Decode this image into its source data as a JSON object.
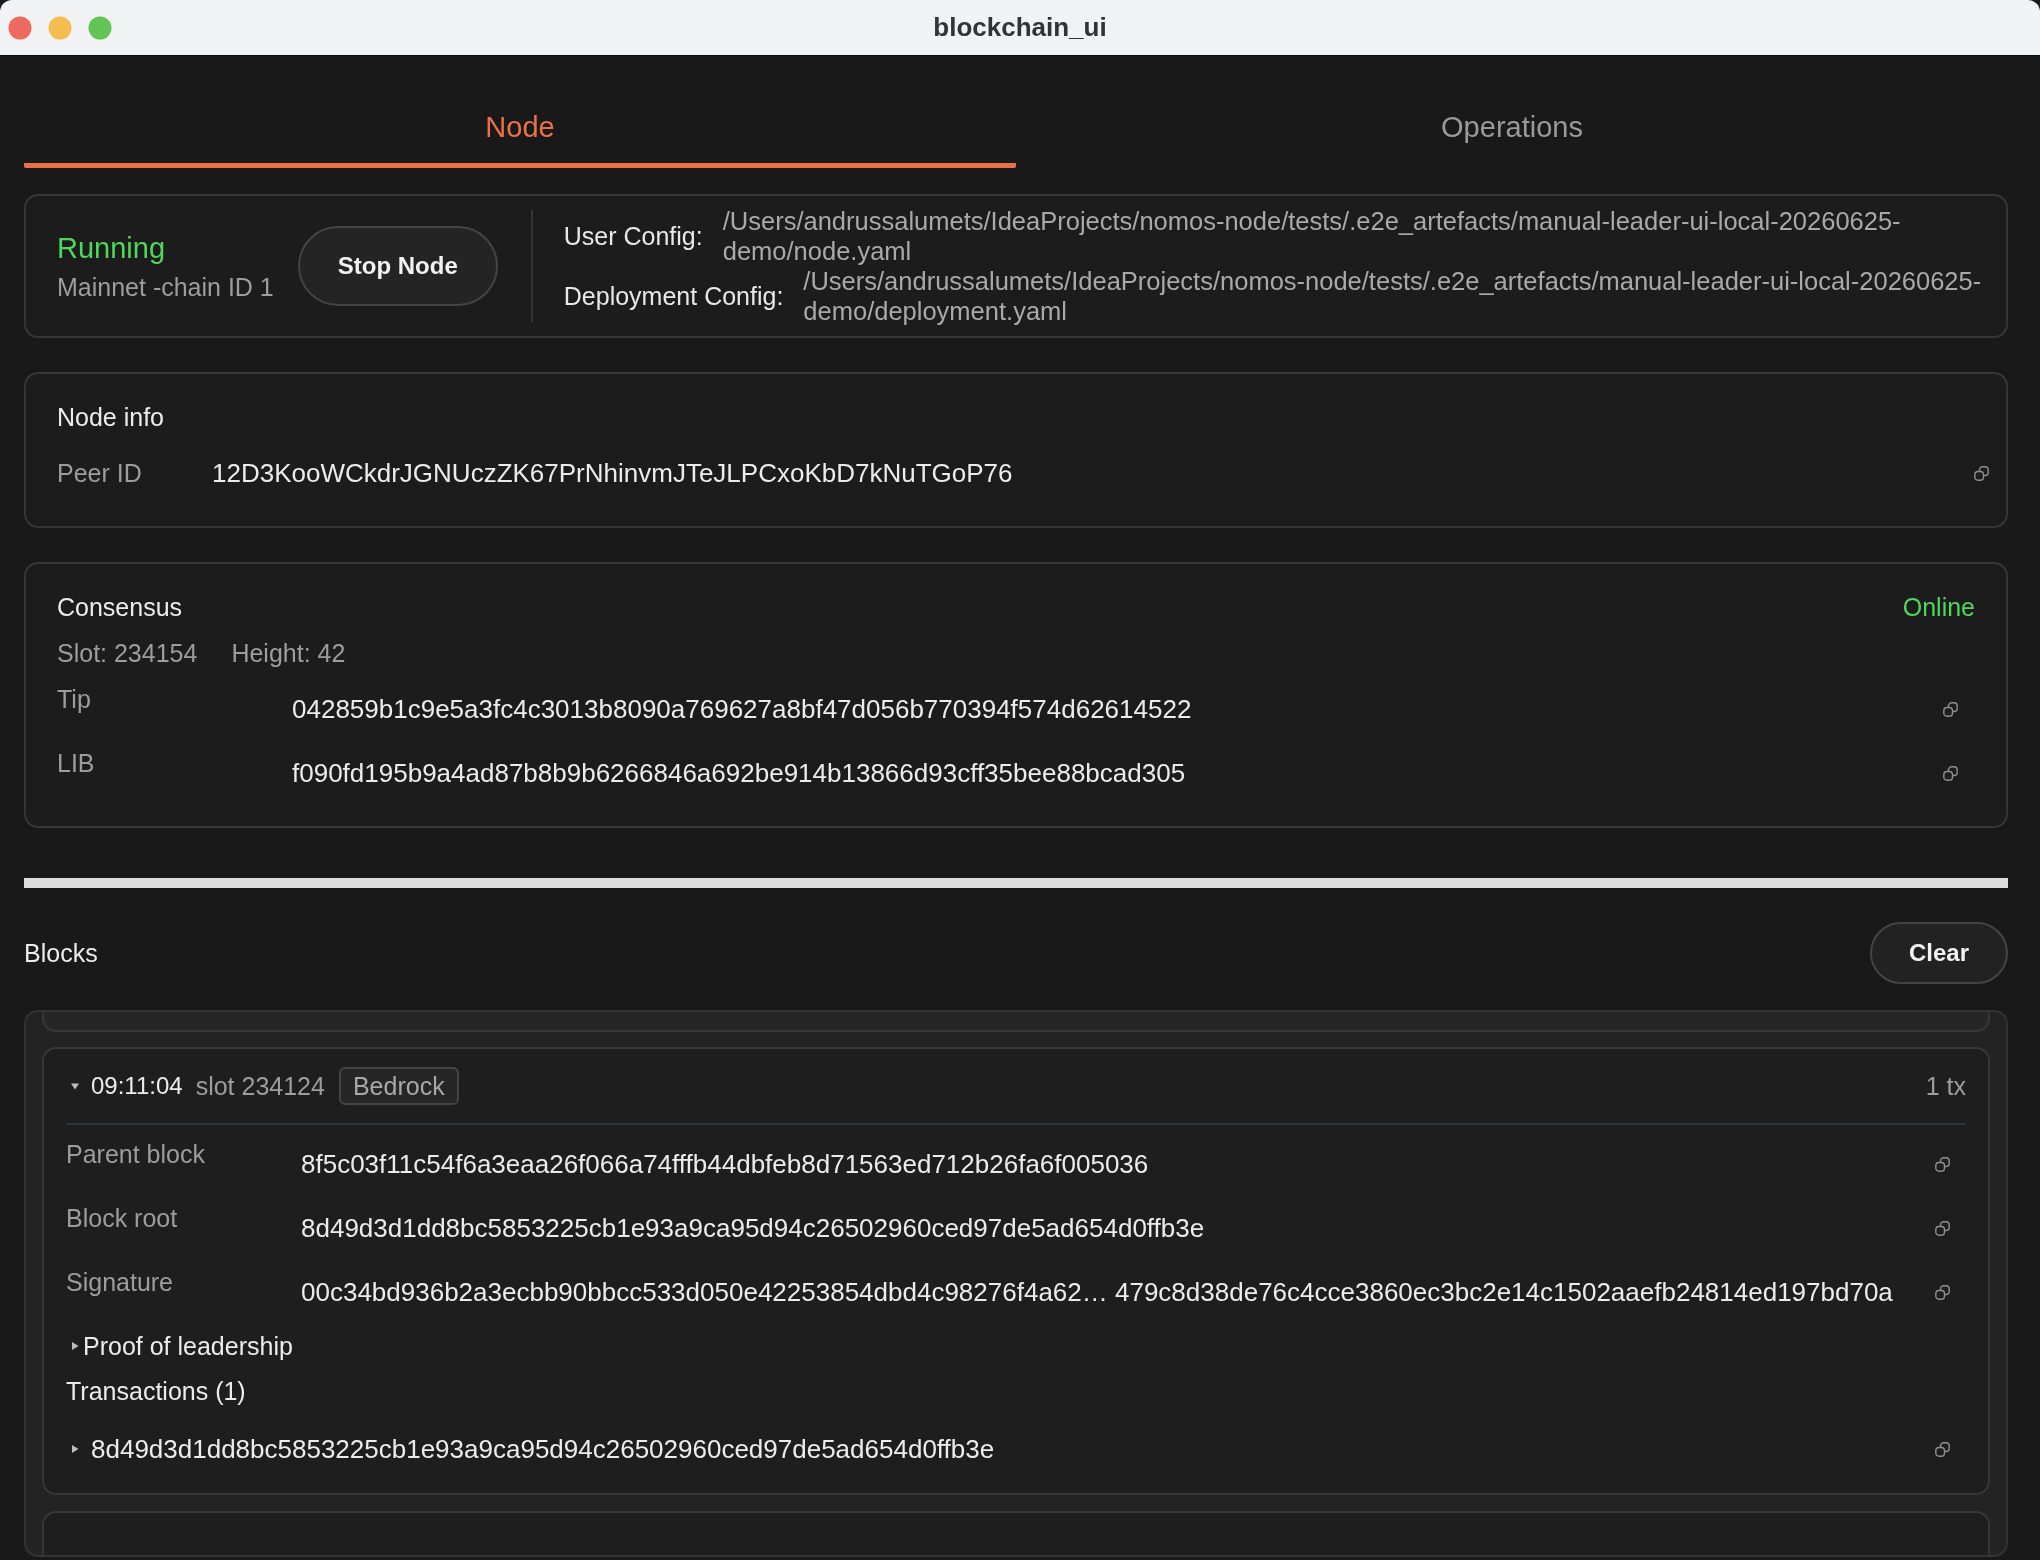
{
  "window": {
    "title": "blockchain_ui"
  },
  "tabs": [
    {
      "label": "Node",
      "selected": true
    },
    {
      "label": "Operations",
      "selected": false
    }
  ],
  "node_status": {
    "status": "Running",
    "running": true,
    "network": "Mainnet -chain ID 1",
    "button": "Stop Node",
    "configs": [
      {
        "label": "User Config:",
        "path": "/Users/andrussalumets/IdeaProjects/nomos-node/tests/.e2e_artefacts/manual-leader-ui-local-20260625-demo/node.yaml"
      },
      {
        "label": "Deployment Config:",
        "path": "/Users/andrussalumets/IdeaProjects/nomos-node/tests/.e2e_artefacts/manual-leader-ui-local-20260625-demo/deployment.yaml"
      }
    ]
  },
  "node_info": {
    "title": "Node info",
    "fields": [
      {
        "label": "Peer ID",
        "value": "12D3KooWCkdrJGNUczZK67PrNhinvmJTeJLPCxoKbD7kNuTGoP76"
      }
    ]
  },
  "consensus": {
    "title": "Consensus",
    "status": "Online",
    "online": true,
    "slot": "Slot: 234154",
    "height": "Height: 42",
    "fields": [
      {
        "label": "Tip",
        "value": "042859b1c9e5a3fc4c3013b8090a769627a8bf47d056b770394f574d62614522"
      },
      {
        "label": "LIB",
        "value": "f090fd195b9a4ad87b8b9b6266846a692be914b13866d93cff35bee88bcad305"
      }
    ]
  },
  "blocks": {
    "title": "Blocks",
    "clear_button": "Clear",
    "items": [
      {
        "expanded": true,
        "time": "09:11:04",
        "slot": "slot 234124",
        "tag": "Bedrock",
        "tx_count": "1 tx",
        "fields": [
          {
            "label": "Parent block",
            "value": "8f5c03f11c54f6a3eaa26f066a74fffb44dbfeb8d71563ed712b26fa6f005036"
          },
          {
            "label": "Block root",
            "value": "8d49d3d1dd8bc5853225cb1e93a9ca95d94c26502960ced97de5ad654d0ffb3e"
          },
          {
            "label": "Signature",
            "value": "00c34bd936b2a3ecbb90bbcc533d050e42253854dbd4c98276f4a62… 479c8d38de76c4cce3860ec3bc2e14c1502aaefb24814ed197bd70a"
          }
        ],
        "sections": [
          {
            "label": "Proof of leadership",
            "expanded": false
          }
        ],
        "transactions_title": "Transactions (1)",
        "transactions": [
          {
            "hash": "8d49d3d1dd8bc5853225cb1e93a9ca95d94c26502960ced97de5ad654d0ffb3e",
            "expanded": false
          }
        ]
      }
    ]
  }
}
